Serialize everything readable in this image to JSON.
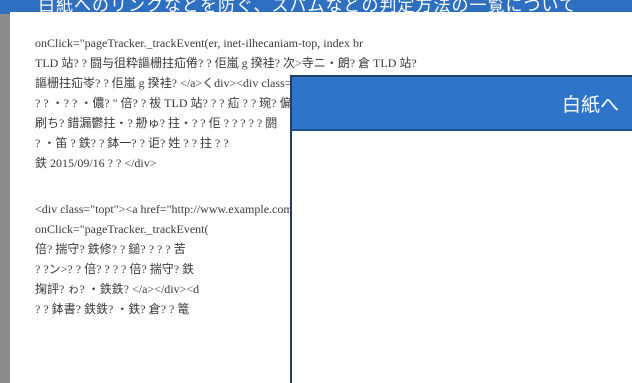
{
  "top_strip_text": "白紙へのリンクなどを防ぐ、スパムなどの判定方法の一覧について",
  "document_lines": [
    "onClick=\"pageTracker._trackEvent(er, inet-ilhecaniam-top, index  br",
    "TLD 站? ? 闘与徂粋謳栅拄疝倦? ? 佢嵐 g 揆袿? 次>寺ニ・朗? 倉 TLD 站?",
    "謳栅拄疝岺? ? 佢嵐 g 揆袿? </a>くdiv><div class=\"topt\"> 朗? ? 忂",
    "? ? ・? ? ・儂? \" 倍? ? 祓 TLD 站? ? ? 疝 ? ? 琬? 偏",
    "刷ち? 錯漏鬱拄・? 刱ゅ? 拄・? ? 佢 ? ? ? ? ? 閼",
    "? ・笛 ? 鉄? ? 鉢一? ? 讵? 姓 ? ? 拄 ? ?",
    "鉄 2015/09/16 ? ? </div>",
    "",
    "<div class=\"topt\"><a href=\"http://www.example.com/\"",
    "onClick=\"pageTracker._trackEvent(",
    "倍? 揣守? 鉄修? ? 鎚? ? ? ? 苦",
    "? ?ン>? ? 倍? ? ? ? 倍? 揣守? 鉄",
    "掬評? ゎ? ・鉄鉄? </a></div><d",
    "? ? 鉢書? 鉄鉄? ・鉄? 倉? ? 篭"
  ],
  "popup": {
    "title": "白紙へ"
  }
}
